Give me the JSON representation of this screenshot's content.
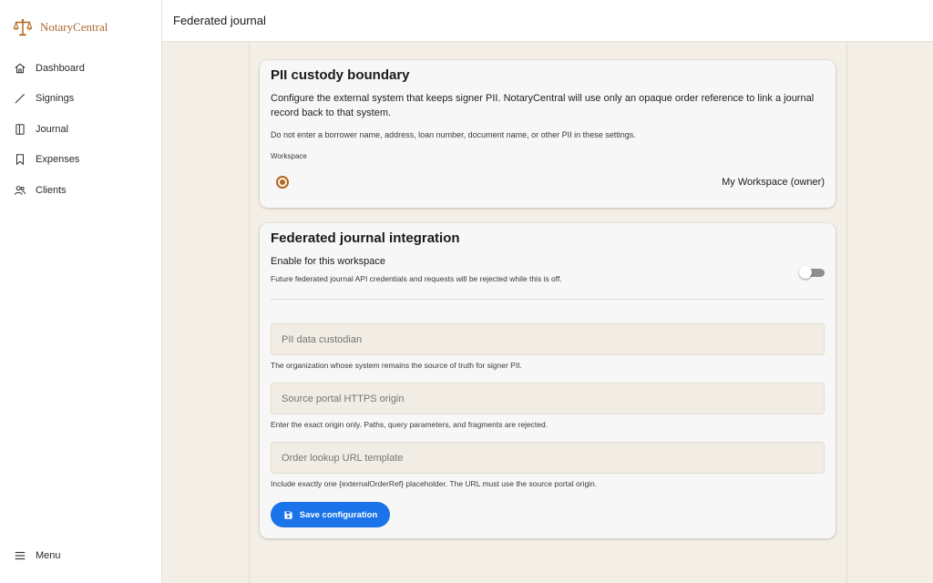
{
  "brand": {
    "name": "NotaryCentral",
    "color": "#a8672a"
  },
  "sidebar": {
    "items": [
      {
        "label": "Dashboard",
        "icon": "home-icon"
      },
      {
        "label": "Signings",
        "icon": "pen-icon"
      },
      {
        "label": "Journal",
        "icon": "book-icon"
      },
      {
        "label": "Expenses",
        "icon": "bookmark-icon"
      },
      {
        "label": "Clients",
        "icon": "people-icon"
      }
    ],
    "menu_label": "Menu"
  },
  "header": {
    "title": "Federated journal"
  },
  "custody": {
    "title": "PII custody boundary",
    "description": "Configure the external system that keeps signer PII. NotaryCentral will use only an opaque order reference to link a journal record back to that system.",
    "warning": "Do not enter a borrower name, address, loan number, document name, or other PII in these settings.",
    "workspace_label": "Workspace",
    "workspace_option": "My Workspace (owner)",
    "workspace_selected": true
  },
  "integration": {
    "title": "Federated journal integration",
    "toggle_label": "Enable for this workspace",
    "toggle_help": "Future federated journal API credentials and requests will be rejected while this is off.",
    "enabled": false,
    "fields": [
      {
        "placeholder": "PII data custodian",
        "value": "",
        "help": "The organization whose system remains the source of truth for signer PII."
      },
      {
        "placeholder": "Source portal HTTPS origin",
        "value": "",
        "help": "Enter the exact origin only. Paths, query parameters, and fragments are rejected."
      },
      {
        "placeholder": "Order lookup URL template",
        "value": "",
        "help": "Include exactly one {externalOrderRef} placeholder. The URL must use the source portal origin."
      }
    ],
    "save_label": "Save configuration"
  },
  "colors": {
    "accent": "#1a73e8",
    "radio": "#b5651d",
    "background": "#f4efe6"
  }
}
